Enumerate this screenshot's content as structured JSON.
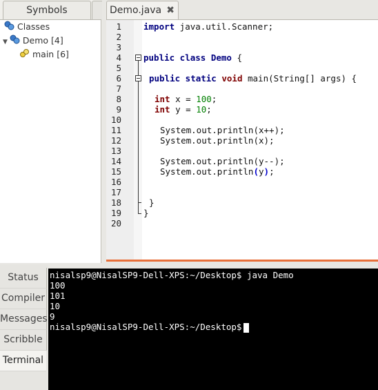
{
  "sidebar": {
    "tab_label": "Symbols",
    "tree": [
      {
        "label": "Classes",
        "icon": "classes-icon"
      },
      {
        "label": "Demo [4]",
        "icon": "class-icon",
        "expander": "▼"
      },
      {
        "label": "main [6]",
        "icon": "method-icon"
      }
    ]
  },
  "editor": {
    "tab_label": "Demo.java",
    "close_glyph": "✖",
    "lines": [
      "1",
      "2",
      "3",
      "4",
      "5",
      "6",
      "7",
      "8",
      "9",
      "10",
      "11",
      "12",
      "13",
      "14",
      "15",
      "16",
      "17",
      "18",
      "19",
      "20"
    ],
    "code": {
      "l1_kw": "import",
      "l1_rest": " java.util.Scanner;",
      "l4_kw": "public class",
      "l4_name": " Demo",
      "l4_brace": " {",
      "l6_kw": "public static",
      "l6_void": "void",
      "l6_rest": " main(String[] args) {",
      "l8_type": "int",
      "l8_mid": " x = ",
      "l8_num": "100",
      "l8_end": ";",
      "l9_type": "int",
      "l9_mid": " y = ",
      "l9_num": "10",
      "l9_end": ";",
      "l11": "System.out.println(x++);",
      "l12": "System.out.println(x);",
      "l14": "System.out.println(y--);",
      "l15_a": "System.out.println",
      "l15_paren": "(",
      "l15_y": "y",
      "l15_close": ")",
      "l15_end": ";",
      "l18": "}",
      "l19": "}"
    },
    "accent_color": "#e8703a"
  },
  "bottom_tabs": [
    {
      "label": "Status"
    },
    {
      "label": "Compiler"
    },
    {
      "label": "Messages"
    },
    {
      "label": "Scribble"
    },
    {
      "label": "Terminal",
      "active": true
    }
  ],
  "terminal": {
    "lines": [
      "nisalsp9@NisalSP9-Dell-XPS:~/Desktop$ java Demo",
      "100",
      "101",
      "10",
      "9",
      "nisalsp9@NisalSP9-Dell-XPS:~/Desktop$"
    ]
  }
}
